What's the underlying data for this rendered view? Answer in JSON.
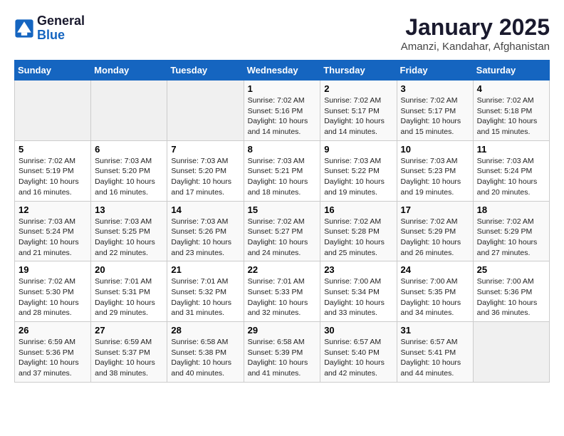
{
  "logo": {
    "general": "General",
    "blue": "Blue"
  },
  "title": "January 2025",
  "subtitle": "Amanzi, Kandahar, Afghanistan",
  "days_of_week": [
    "Sunday",
    "Monday",
    "Tuesday",
    "Wednesday",
    "Thursday",
    "Friday",
    "Saturday"
  ],
  "weeks": [
    [
      {
        "day": "",
        "info": ""
      },
      {
        "day": "",
        "info": ""
      },
      {
        "day": "",
        "info": ""
      },
      {
        "day": "1",
        "info": "Sunrise: 7:02 AM\nSunset: 5:16 PM\nDaylight: 10 hours\nand 14 minutes."
      },
      {
        "day": "2",
        "info": "Sunrise: 7:02 AM\nSunset: 5:17 PM\nDaylight: 10 hours\nand 14 minutes."
      },
      {
        "day": "3",
        "info": "Sunrise: 7:02 AM\nSunset: 5:17 PM\nDaylight: 10 hours\nand 15 minutes."
      },
      {
        "day": "4",
        "info": "Sunrise: 7:02 AM\nSunset: 5:18 PM\nDaylight: 10 hours\nand 15 minutes."
      }
    ],
    [
      {
        "day": "5",
        "info": "Sunrise: 7:02 AM\nSunset: 5:19 PM\nDaylight: 10 hours\nand 16 minutes."
      },
      {
        "day": "6",
        "info": "Sunrise: 7:03 AM\nSunset: 5:20 PM\nDaylight: 10 hours\nand 16 minutes."
      },
      {
        "day": "7",
        "info": "Sunrise: 7:03 AM\nSunset: 5:20 PM\nDaylight: 10 hours\nand 17 minutes."
      },
      {
        "day": "8",
        "info": "Sunrise: 7:03 AM\nSunset: 5:21 PM\nDaylight: 10 hours\nand 18 minutes."
      },
      {
        "day": "9",
        "info": "Sunrise: 7:03 AM\nSunset: 5:22 PM\nDaylight: 10 hours\nand 19 minutes."
      },
      {
        "day": "10",
        "info": "Sunrise: 7:03 AM\nSunset: 5:23 PM\nDaylight: 10 hours\nand 19 minutes."
      },
      {
        "day": "11",
        "info": "Sunrise: 7:03 AM\nSunset: 5:24 PM\nDaylight: 10 hours\nand 20 minutes."
      }
    ],
    [
      {
        "day": "12",
        "info": "Sunrise: 7:03 AM\nSunset: 5:24 PM\nDaylight: 10 hours\nand 21 minutes."
      },
      {
        "day": "13",
        "info": "Sunrise: 7:03 AM\nSunset: 5:25 PM\nDaylight: 10 hours\nand 22 minutes."
      },
      {
        "day": "14",
        "info": "Sunrise: 7:03 AM\nSunset: 5:26 PM\nDaylight: 10 hours\nand 23 minutes."
      },
      {
        "day": "15",
        "info": "Sunrise: 7:02 AM\nSunset: 5:27 PM\nDaylight: 10 hours\nand 24 minutes."
      },
      {
        "day": "16",
        "info": "Sunrise: 7:02 AM\nSunset: 5:28 PM\nDaylight: 10 hours\nand 25 minutes."
      },
      {
        "day": "17",
        "info": "Sunrise: 7:02 AM\nSunset: 5:29 PM\nDaylight: 10 hours\nand 26 minutes."
      },
      {
        "day": "18",
        "info": "Sunrise: 7:02 AM\nSunset: 5:29 PM\nDaylight: 10 hours\nand 27 minutes."
      }
    ],
    [
      {
        "day": "19",
        "info": "Sunrise: 7:02 AM\nSunset: 5:30 PM\nDaylight: 10 hours\nand 28 minutes."
      },
      {
        "day": "20",
        "info": "Sunrise: 7:01 AM\nSunset: 5:31 PM\nDaylight: 10 hours\nand 29 minutes."
      },
      {
        "day": "21",
        "info": "Sunrise: 7:01 AM\nSunset: 5:32 PM\nDaylight: 10 hours\nand 31 minutes."
      },
      {
        "day": "22",
        "info": "Sunrise: 7:01 AM\nSunset: 5:33 PM\nDaylight: 10 hours\nand 32 minutes."
      },
      {
        "day": "23",
        "info": "Sunrise: 7:00 AM\nSunset: 5:34 PM\nDaylight: 10 hours\nand 33 minutes."
      },
      {
        "day": "24",
        "info": "Sunrise: 7:00 AM\nSunset: 5:35 PM\nDaylight: 10 hours\nand 34 minutes."
      },
      {
        "day": "25",
        "info": "Sunrise: 7:00 AM\nSunset: 5:36 PM\nDaylight: 10 hours\nand 36 minutes."
      }
    ],
    [
      {
        "day": "26",
        "info": "Sunrise: 6:59 AM\nSunset: 5:36 PM\nDaylight: 10 hours\nand 37 minutes."
      },
      {
        "day": "27",
        "info": "Sunrise: 6:59 AM\nSunset: 5:37 PM\nDaylight: 10 hours\nand 38 minutes."
      },
      {
        "day": "28",
        "info": "Sunrise: 6:58 AM\nSunset: 5:38 PM\nDaylight: 10 hours\nand 40 minutes."
      },
      {
        "day": "29",
        "info": "Sunrise: 6:58 AM\nSunset: 5:39 PM\nDaylight: 10 hours\nand 41 minutes."
      },
      {
        "day": "30",
        "info": "Sunrise: 6:57 AM\nSunset: 5:40 PM\nDaylight: 10 hours\nand 42 minutes."
      },
      {
        "day": "31",
        "info": "Sunrise: 6:57 AM\nSunset: 5:41 PM\nDaylight: 10 hours\nand 44 minutes."
      },
      {
        "day": "",
        "info": ""
      }
    ]
  ]
}
